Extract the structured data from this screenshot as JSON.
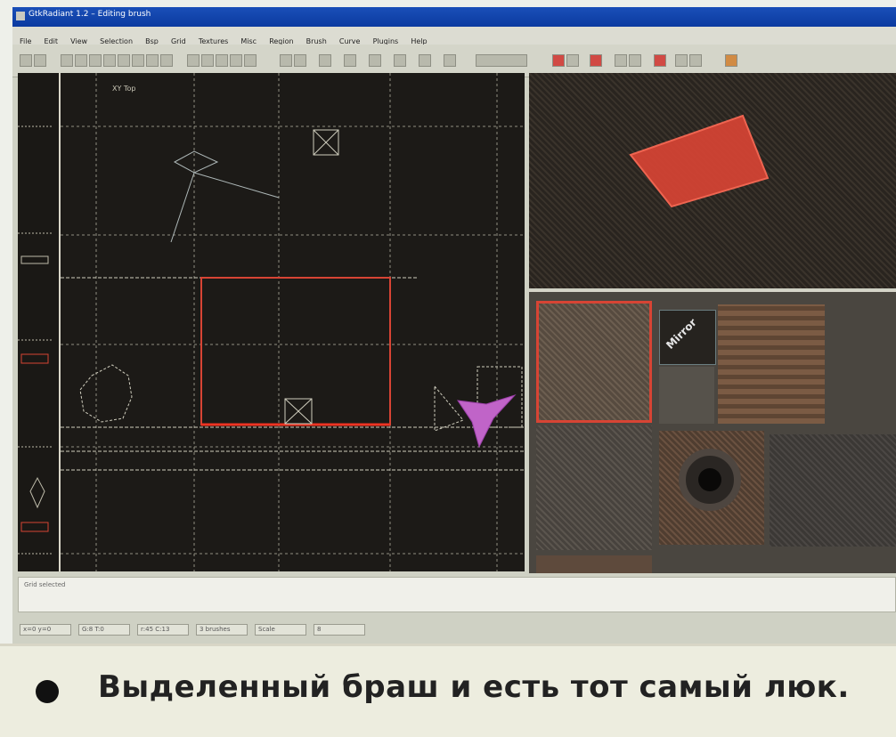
{
  "window": {
    "title": "GtkRadiant 1.2 – Editing brush",
    "menu": [
      "File",
      "Edit",
      "View",
      "Selection",
      "Bsp",
      "Grid",
      "Textures",
      "Misc",
      "Region",
      "Brush",
      "Curve",
      "Plugins",
      "Help"
    ]
  },
  "viewport": {
    "top_label": "XY Top"
  },
  "texture_browser": {
    "mirror_label": "Mirror"
  },
  "console": {
    "line": "Grid selected"
  },
  "statusbar": {
    "fields": [
      "x=0 y=0",
      "G:8 T:0",
      "r:45 C:13",
      "3 brushes",
      "Scale",
      "8"
    ]
  },
  "caption": {
    "text": "Выделенный браш и есть тот самый люк."
  },
  "colors": {
    "selected_brush": "#d74434",
    "grid_line": "#b9b7a6",
    "entity": "#c064c8",
    "caption_text": "#222222"
  }
}
